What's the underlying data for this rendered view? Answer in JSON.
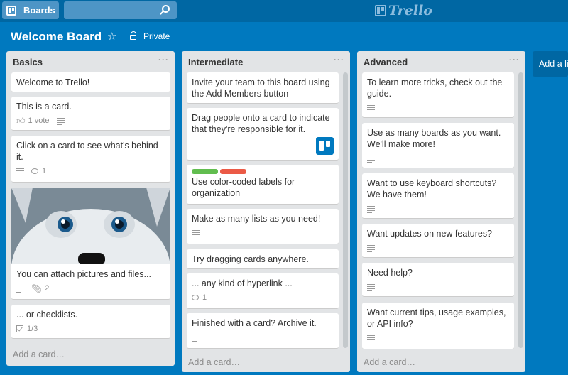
{
  "header": {
    "boards_label": "Boards",
    "search_value": "",
    "logo_text": "Trello"
  },
  "board": {
    "title": "Welcome Board",
    "visibility": "Private"
  },
  "lists": [
    {
      "title": "Basics",
      "add_card": "Add a card…",
      "cards": [
        {
          "title": "Welcome to Trello!"
        },
        {
          "title": "This is a card.",
          "votes": "1 vote"
        },
        {
          "title": "Click on a card to see what's behind it.",
          "comments": "1"
        },
        {
          "title": "You can attach pictures and files...",
          "attachments": "2"
        },
        {
          "title": "... or checklists.",
          "checklist": "1/3"
        }
      ]
    },
    {
      "title": "Intermediate",
      "add_card": "Add a card…",
      "cards": [
        {
          "title": "Invite your team to this board using the Add Members button"
        },
        {
          "title": "Drag people onto a card to indicate that they're responsible for it."
        },
        {
          "title": "Use color-coded labels for organization"
        },
        {
          "title": "Make as many lists as you need!"
        },
        {
          "title": "Try dragging cards anywhere."
        },
        {
          "title": "... any kind of hyperlink ...",
          "comments": "1"
        },
        {
          "title": "Finished with a card? Archive it."
        }
      ]
    },
    {
      "title": "Advanced",
      "add_card": "Add a card…",
      "cards": [
        {
          "title": "To learn more tricks, check out the guide."
        },
        {
          "title": "Use as many boards as you want. We'll make more!"
        },
        {
          "title": "Want to use keyboard shortcuts? We have them!"
        },
        {
          "title": "Want updates on new features?"
        },
        {
          "title": "Need help?"
        },
        {
          "title": "Want current tips, usage examples, or API info?"
        }
      ]
    }
  ],
  "add_list_label": "Add a list…",
  "colors": {
    "board_bg": "#0079bf",
    "header_bg": "#0067a3",
    "list_bg": "#e2e4e6",
    "label_green": "#61bd4f",
    "label_red": "#eb5a46"
  }
}
